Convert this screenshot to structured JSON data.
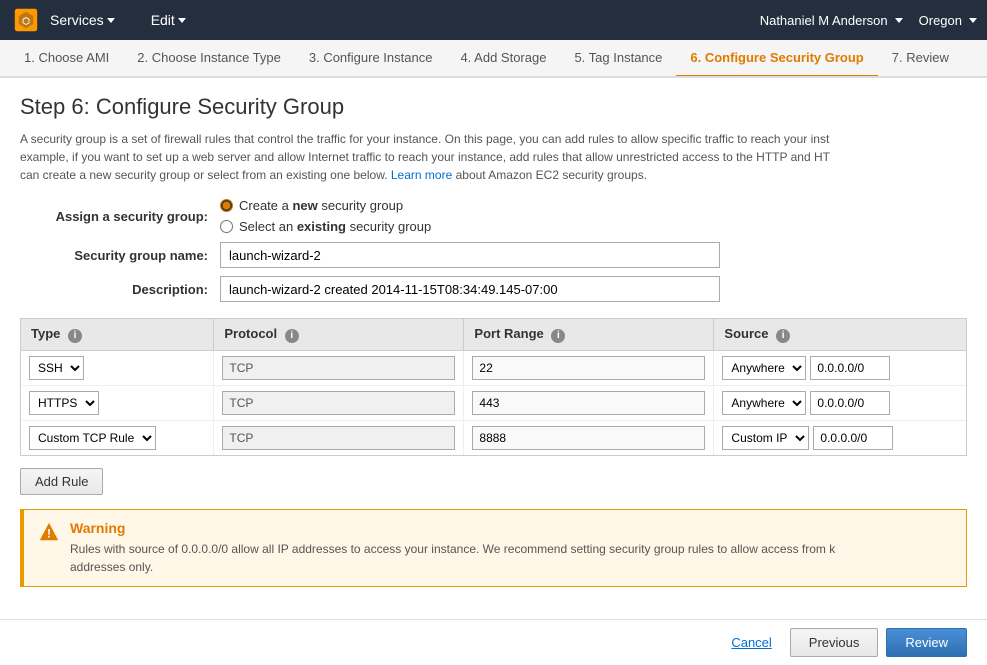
{
  "topnav": {
    "services_label": "Services",
    "edit_label": "Edit",
    "user_label": "Nathaniel M Anderson",
    "region_label": "Oregon"
  },
  "wizard_tabs": [
    {
      "id": "tab-1",
      "label": "1. Choose AMI",
      "active": false
    },
    {
      "id": "tab-2",
      "label": "2. Choose Instance Type",
      "active": false
    },
    {
      "id": "tab-3",
      "label": "3. Configure Instance",
      "active": false
    },
    {
      "id": "tab-4",
      "label": "4. Add Storage",
      "active": false
    },
    {
      "id": "tab-5",
      "label": "5. Tag Instance",
      "active": false
    },
    {
      "id": "tab-6",
      "label": "6. Configure Security Group",
      "active": true
    },
    {
      "id": "tab-7",
      "label": "7. Review",
      "active": false
    }
  ],
  "page": {
    "title": "Step 6: Configure Security Group",
    "description_part1": "A security group is a set of firewall rules that control the traffic for your instance. On this page, you can add rules to allow specific traffic to reach your inst",
    "description_part2": "example, if you want to set up a web server and allow Internet traffic to reach your instance, add rules that allow unrestricted access to the HTTP and HT",
    "description_part3": "can create a new security group or select from an existing one below.",
    "learn_more_text": "Learn more",
    "description_part4": "about Amazon EC2 security groups."
  },
  "form": {
    "assign_label": "Assign a security group:",
    "radio_new_label": "Create a ",
    "radio_new_bold": "new",
    "radio_new_end": " security group",
    "radio_existing_label": "Select an ",
    "radio_existing_bold": "existing",
    "radio_existing_end": " security group",
    "name_label": "Security group name:",
    "name_value": "launch-wizard-2",
    "desc_label": "Description:",
    "desc_value": "launch-wizard-2 created 2014-11-15T08:34:49.145-07:00"
  },
  "table": {
    "headers": [
      {
        "label": "Type",
        "info": true
      },
      {
        "label": "Protocol",
        "info": true
      },
      {
        "label": "Port Range",
        "info": true
      },
      {
        "label": "Source",
        "info": true
      }
    ],
    "rows": [
      {
        "type": "SSH",
        "protocol": "TCP",
        "port_range": "22",
        "source_type": "Anywhere",
        "source_value": "0.0.0.0/0"
      },
      {
        "type": "HTTPS",
        "protocol": "TCP",
        "port_range": "443",
        "source_type": "Anywhere",
        "source_value": "0.0.0.0/0"
      },
      {
        "type": "Custom TCP Rule",
        "protocol": "TCP",
        "port_range": "8888",
        "source_type": "Custom IP",
        "source_value": "0.0.0.0/0"
      }
    ]
  },
  "buttons": {
    "add_rule": "Add Rule",
    "cancel": "Cancel",
    "previous": "Previous",
    "review": "Review"
  },
  "warning": {
    "title": "Warning",
    "text_part1": "Rules with source of 0.0.0.0/0 allow all IP addresses to access your instance. We recommend setting security group rules to allow access from k",
    "text_part2": "addresses only."
  }
}
